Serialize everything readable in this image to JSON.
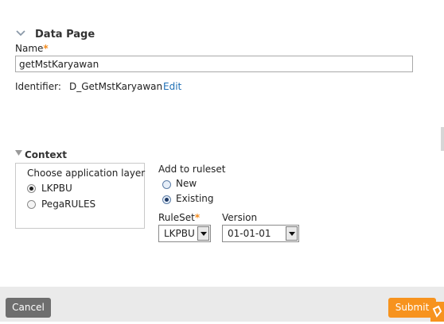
{
  "data_page_section": {
    "title": "Data Page",
    "name_label": "Name",
    "required_mark": "*",
    "name_value": "getMstKaryawan",
    "identifier_label": "Identifier:",
    "identifier_value": "D_GetMstKaryawan",
    "edit_link": "Edit"
  },
  "context_section": {
    "title": "Context",
    "layer_heading": "Choose application layer",
    "layers": [
      {
        "label": "LKPBU",
        "selected": true
      },
      {
        "label": "PegaRULES",
        "selected": false
      }
    ],
    "add_to_ruleset_label": "Add to ruleset",
    "ruleset_modes": [
      {
        "label": "New",
        "selected": false
      },
      {
        "label": "Existing",
        "selected": true
      }
    ],
    "ruleset_label": "RuleSet",
    "ruleset_value": "LKPBU",
    "version_label": "Version",
    "version_value": "01-01-01"
  },
  "footer": {
    "cancel_label": "Cancel",
    "submit_label": "Submit"
  },
  "colors": {
    "accent_orange": "#f7931e",
    "link_blue": "#1f6fb5",
    "cancel_gray": "#6e6e6e"
  }
}
